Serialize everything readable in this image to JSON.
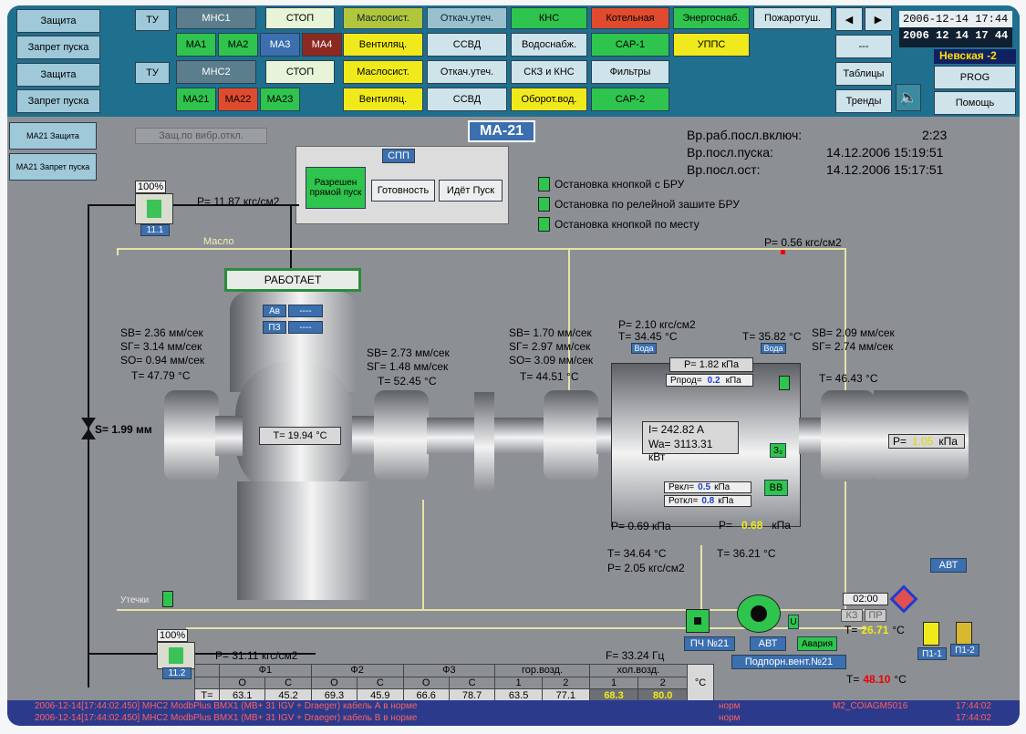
{
  "top": {
    "left_buttons": [
      "Защита",
      "Запрет пуска",
      "Защита",
      "Запрет пуска"
    ],
    "ty": "ТУ",
    "mns1": "МНС1",
    "mns2": "МНС2",
    "stop": "СТОП",
    "ma_row1": [
      "МА1",
      "МА2",
      "МА3",
      "МА4"
    ],
    "ma_row2": [
      "МА21",
      "МА22",
      "МА23"
    ],
    "col1": [
      "Маслосист.",
      "Вентиляц.",
      "Маслосист.",
      "Вентиляц."
    ],
    "col2": [
      "Откач.утеч.",
      "ССВД",
      "Откач.утеч.",
      "ССВД"
    ],
    "col3": [
      "КНС",
      "Водоснабж.",
      "СКЗ и КНС",
      "Оборот.вод."
    ],
    "col4": [
      "Котельная",
      "САР-1",
      "Фильтры",
      "САР-2"
    ],
    "col5": [
      "Энергоснаб.",
      "УППС"
    ],
    "pozh": "Пожаротуш.",
    "arrows": [
      "◀",
      "▶"
    ],
    "dash": "---",
    "tables": "Таблицы",
    "trends": "Тренды",
    "datetime1": "2006-12-14  17:44",
    "datetime2": "2006 12 14  17 44",
    "station": "Невская -2",
    "prog": "PROG",
    "help": "Помощь",
    "speaker_icon": "speaker-icon"
  },
  "left_side": [
    "МА21 Защита",
    "МА21 Запрет пуска"
  ],
  "main": {
    "title": "МА-21",
    "vib_off": "Защ.по вибр.откл.",
    "times": [
      {
        "label": "Вр.раб.посл.включ:",
        "value": "2:23"
      },
      {
        "label": "Вр.посл.пуска:",
        "value": "14.12.2006    15:19:51"
      },
      {
        "label": "Вр.посл.ост:",
        "value": "14.12.2006    15:17:51"
      }
    ],
    "spp": {
      "title": "СПП",
      "allowed": "Разрешен прямой пуск",
      "ready": "Готовность",
      "starting": "Идёт Пуск"
    },
    "stops": [
      "Остановка кнопкой с БРУ",
      "Остановка по релейной зашите БРУ",
      "Остановка кнопкой по месту"
    ],
    "valve_top": {
      "pct": "100%",
      "id": "11.1",
      "p": "P=  11.87 кгс/см2"
    },
    "valve_bot": {
      "pct": "100%",
      "id": "11.2",
      "p": "P=  31.11 кгс/см2"
    },
    "maslo": "Масло",
    "p_top_right": "P=    0.56 кгс/см2",
    "works": "РАБОТАЕТ",
    "av": "Ав",
    "pz": "ПЗ",
    "av_val": "----",
    "pz_val": "----",
    "left_vib": [
      "SB=   2.36 мм/сек",
      "SГ=   3.14 мм/сек",
      "SO=   0.94 мм/сек",
      "T=  47.79 °C"
    ],
    "s_label": "S=    1.99 мм",
    "pump_temp": "T=  19.94 °C",
    "mid_vib": [
      "SB=   2.73 мм/сек",
      "SГ=   1.48 мм/сек",
      "T=  52.45 °C"
    ],
    "c_vib": [
      "SB=   1.70 мм/сек",
      "SГ=   2.97 мм/сек",
      "SO=   3.09 мм/сек",
      "T=  44.51 °C"
    ],
    "water_p": "P=    2.10 кгс/см2",
    "water_t": "T=  34.45 °C",
    "water_t2": "T=  35.82 °C",
    "voda": "Вода",
    "r_vib": [
      "SB=   2.09 мм/сек",
      "SГ=   2.74 мм/сек",
      "T=  46.43 °C"
    ],
    "motor_p": "P=    1.82 кПа",
    "motor_pprod_label": "Рпрод=",
    "motor_pprod_val": "0.2",
    "motor_pprod_unit": "кПа",
    "current": "I=    242.82 A",
    "power": "Wa=  3113.31 кВт",
    "z3": "З₃",
    "pvkl_label": "Рвкл=",
    "pvkl_val": "0.5",
    "potkl_label": "Роткл=",
    "potkl_val": "0.8",
    "kpa": "кПа",
    "vv": "ВВ",
    "p_left_bottom": "P=    0.69 кПа",
    "p_right_bottom_label": "P=",
    "p_right_bottom_val": "0.68",
    "p_far_right_label": "P=",
    "p_far_right_val": "1.05",
    "bottom_t1": "T=   34.64 °C",
    "bottom_p1": "P=    2.05 кгс/см2",
    "bottom_t2": "T=   36.21 °C",
    "utechki": "Утечки",
    "freq": "F=  33.24 Гц",
    "pch": "ПЧ №21",
    "avt": "АВТ",
    "avaria": "Авария",
    "fan": "Подпорн.вент.№21",
    "u": "U",
    "timer": "02:00",
    "kz": "КЗ",
    "pr": "ПР",
    "t_yellow_label": "T=",
    "t_yellow_val": "26.71",
    "t_red_label": "T=",
    "t_red_val": "48.10",
    "deg": "°C",
    "avt2": "АВТ",
    "p11": "П1-1",
    "p12": "П1-2"
  },
  "table": {
    "groups": [
      "Ф1",
      "Ф2",
      "Ф3",
      "гор.возд.",
      "хол.возд."
    ],
    "sub": [
      "О",
      "С",
      "О",
      "С",
      "О",
      "С",
      "1",
      "2",
      "1",
      "2"
    ],
    "row_label": "T=",
    "values": [
      "63.1",
      "45.2",
      "69.3",
      "45.9",
      "66.6",
      "78.7",
      "63.5",
      "77.1",
      "68.3",
      "80.0"
    ],
    "unit": "°C"
  },
  "status": {
    "line1": "2006-12-14[17:44:02.450] МНС2 ModbPlus BMX1 (MB+ 31 IGV + Draeger) кабель А в норме",
    "line2": "2006-12-14[17:44:02.450] МНС2 ModbPlus BMX1 (MB+ 31 IGV + Draeger) кабель В в норме",
    "norm": "норм",
    "norm2": "норм",
    "code": "М2_COIAGM5016",
    "t1": "17:44:02",
    "t2": "17:44:02"
  }
}
